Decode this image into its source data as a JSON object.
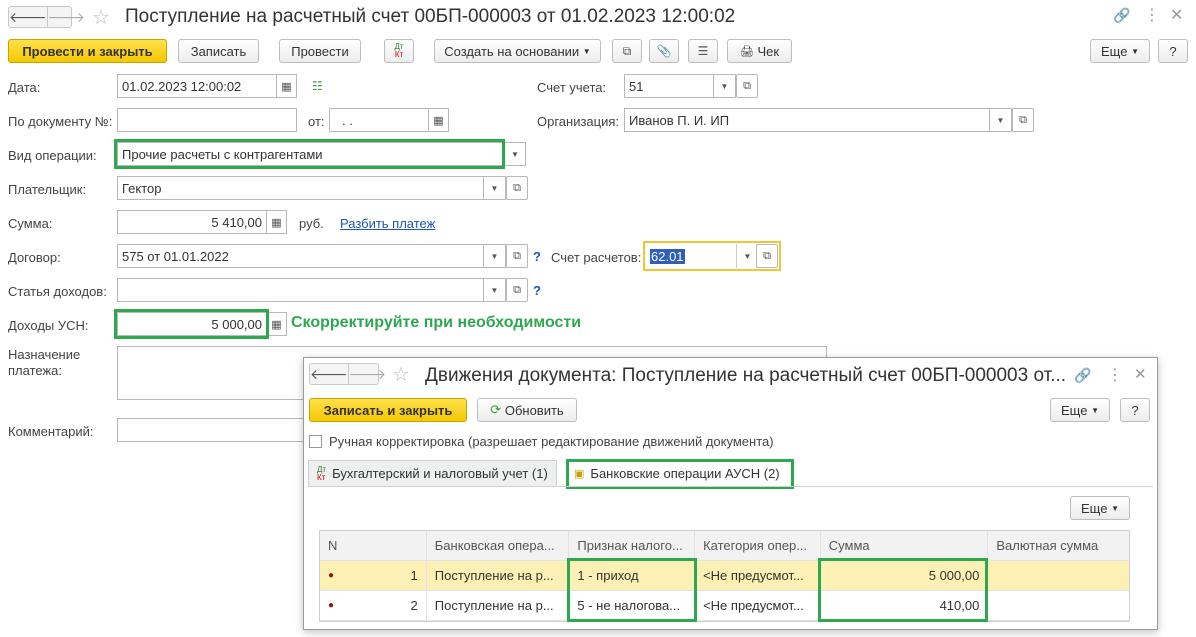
{
  "window": {
    "title": "Поступление на расчетный счет 00БП-000003 от 01.02.2023 12:00:02",
    "nav_back": "🡐",
    "nav_forward": "🡒"
  },
  "toolbar": {
    "post_close": "Провести и закрыть",
    "save": "Записать",
    "post": "Провести",
    "dt_kt": "Дт Кт",
    "create_based": "Создать на основании",
    "check": "Чек",
    "more": "Еще",
    "help": "?"
  },
  "form": {
    "date_label": "Дата:",
    "date_value": "01.02.2023 12:00:02",
    "doc_num_label": "По документу №:",
    "doc_num_value": "",
    "from_label": "от:",
    "from_value": ". .",
    "operation_label": "Вид операции:",
    "operation_value": "Прочие расчеты с контрагентами",
    "payer_label": "Плательщик:",
    "payer_value": "Гектор",
    "sum_label": "Сумма:",
    "sum_value": "5 410,00",
    "currency": "руб.",
    "split_link": "Разбить платеж",
    "contract_label": "Договор:",
    "contract_value": "575 от 01.01.2022",
    "income_item_label": "Статья доходов:",
    "income_item_value": "",
    "usn_income_label": "Доходы УСН:",
    "usn_income_value": "5 000,00",
    "hint": "Скорректируйте при необходимости",
    "purpose_label": "Назначение платежа:",
    "comment_label": "Комментарий:",
    "account_label": "Счет учета:",
    "account_value": "51",
    "org_label": "Организация:",
    "org_value": "Иванов П. И. ИП",
    "settle_label": "Счет расчетов:",
    "settle_value": "62.01",
    "q": "?"
  },
  "modal": {
    "title": "Движения документа: Поступление на расчетный счет 00БП-000003 от...",
    "save_close": "Записать и закрыть",
    "refresh": "Обновить",
    "more": "Еще",
    "help": "?",
    "manual_label": "Ручная корректировка (разрешает редактирование движений документа)",
    "tab1": "Бухгалтерский и налоговый учет (1)",
    "tab2": "Банковские операции АУСН (2)",
    "grid_more": "Еще",
    "columns": [
      "N",
      "Банковская опера...",
      "Признак налого...",
      "Категория опер...",
      "Сумма",
      "Валютная сумма"
    ],
    "rows": [
      {
        "n": "1",
        "op": "Поступление на р...",
        "tax": "1 - приход",
        "cat": "<Не предусмот...",
        "sum": "5 000,00",
        "cur": ""
      },
      {
        "n": "2",
        "op": "Поступление на р...",
        "tax": "5 - не налогова...",
        "cat": "<Не предусмот...",
        "sum": "410,00",
        "cur": ""
      }
    ]
  },
  "colors": {
    "accent_yellow": "#f5c800",
    "highlight_green": "#2ea84f",
    "link_blue": "#1a55b8"
  }
}
